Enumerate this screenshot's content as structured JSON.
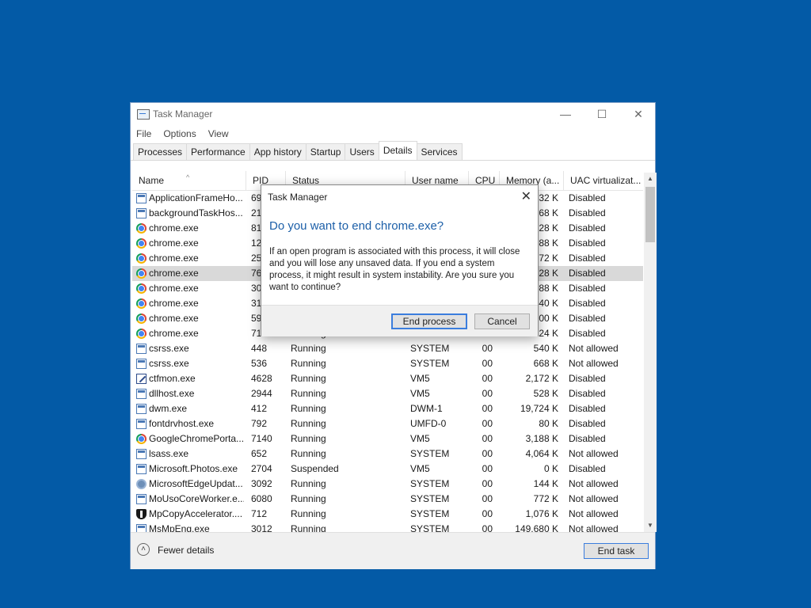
{
  "window": {
    "title": "Task Manager",
    "minimize_glyph": "—",
    "maximize_glyph": "☐",
    "close_glyph": "✕",
    "menu": [
      "File",
      "Options",
      "View"
    ],
    "tabs": [
      "Processes",
      "Performance",
      "App history",
      "Startup",
      "Users",
      "Details",
      "Services"
    ],
    "active_tab": "Details"
  },
  "table": {
    "columns": [
      "Name",
      "PID",
      "Status",
      "User name",
      "CPU",
      "Memory (a...",
      "UAC virtualizat..."
    ],
    "sort_glyph": "^",
    "rows": [
      {
        "icon": "app-window-icon",
        "name": "ApplicationFrameHo...",
        "pid": "69",
        "status": "",
        "user": "",
        "cpu": "",
        "mem": "32 K",
        "uac": "Disabled"
      },
      {
        "icon": "app-window-icon",
        "name": "backgroundTaskHos...",
        "pid": "21",
        "status": "",
        "user": "",
        "cpu": "",
        "mem": "68 K",
        "uac": "Disabled"
      },
      {
        "icon": "chrome-icon",
        "name": "chrome.exe",
        "pid": "81",
        "status": "",
        "user": "",
        "cpu": "",
        "mem": "28 K",
        "uac": "Disabled"
      },
      {
        "icon": "chrome-icon",
        "name": "chrome.exe",
        "pid": "12",
        "status": "",
        "user": "",
        "cpu": "",
        "mem": "88 K",
        "uac": "Disabled"
      },
      {
        "icon": "chrome-icon",
        "name": "chrome.exe",
        "pid": "25",
        "status": "",
        "user": "",
        "cpu": "",
        "mem": "72 K",
        "uac": "Disabled"
      },
      {
        "icon": "chrome-icon",
        "name": "chrome.exe",
        "pid": "76",
        "status": "",
        "user": "",
        "cpu": "",
        "mem": "28 K",
        "uac": "Disabled",
        "selected": true
      },
      {
        "icon": "chrome-icon",
        "name": "chrome.exe",
        "pid": "30",
        "status": "",
        "user": "",
        "cpu": "",
        "mem": "88 K",
        "uac": "Disabled"
      },
      {
        "icon": "chrome-icon",
        "name": "chrome.exe",
        "pid": "31",
        "status": "",
        "user": "",
        "cpu": "",
        "mem": "40 K",
        "uac": "Disabled"
      },
      {
        "icon": "chrome-icon",
        "name": "chrome.exe",
        "pid": "59",
        "status": "",
        "user": "",
        "cpu": "",
        "mem": "00 K",
        "uac": "Disabled"
      },
      {
        "icon": "chrome-icon",
        "name": "chrome.exe",
        "pid": "71",
        "status": "Running",
        "user": "VM5",
        "cpu": "",
        "mem": "024 K",
        "uac": "Disabled"
      },
      {
        "icon": "app-window-icon",
        "name": "csrss.exe",
        "pid": "448",
        "status": "Running",
        "user": "SYSTEM",
        "cpu": "00",
        "mem": "540 K",
        "uac": "Not allowed"
      },
      {
        "icon": "app-window-icon",
        "name": "csrss.exe",
        "pid": "536",
        "status": "Running",
        "user": "SYSTEM",
        "cpu": "00",
        "mem": "668 K",
        "uac": "Not allowed"
      },
      {
        "icon": "pen-icon",
        "name": "ctfmon.exe",
        "pid": "4628",
        "status": "Running",
        "user": "VM5",
        "cpu": "00",
        "mem": "2,172 K",
        "uac": "Disabled"
      },
      {
        "icon": "app-window-icon",
        "name": "dllhost.exe",
        "pid": "2944",
        "status": "Running",
        "user": "VM5",
        "cpu": "00",
        "mem": "528 K",
        "uac": "Disabled"
      },
      {
        "icon": "app-window-icon",
        "name": "dwm.exe",
        "pid": "412",
        "status": "Running",
        "user": "DWM-1",
        "cpu": "00",
        "mem": "19,724 K",
        "uac": "Disabled"
      },
      {
        "icon": "app-window-icon",
        "name": "fontdrvhost.exe",
        "pid": "792",
        "status": "Running",
        "user": "UMFD-0",
        "cpu": "00",
        "mem": "80 K",
        "uac": "Disabled"
      },
      {
        "icon": "chrome-icon",
        "name": "GoogleChromePorta...",
        "pid": "7140",
        "status": "Running",
        "user": "VM5",
        "cpu": "00",
        "mem": "3,188 K",
        "uac": "Disabled"
      },
      {
        "icon": "app-window-icon",
        "name": "lsass.exe",
        "pid": "652",
        "status": "Running",
        "user": "SYSTEM",
        "cpu": "00",
        "mem": "4,064 K",
        "uac": "Not allowed"
      },
      {
        "icon": "app-window-icon",
        "name": "Microsoft.Photos.exe",
        "pid": "2704",
        "status": "Suspended",
        "user": "VM5",
        "cpu": "00",
        "mem": "0 K",
        "uac": "Disabled"
      },
      {
        "icon": "gear-icon",
        "name": "MicrosoftEdgeUpdat...",
        "pid": "3092",
        "status": "Running",
        "user": "SYSTEM",
        "cpu": "00",
        "mem": "144 K",
        "uac": "Not allowed"
      },
      {
        "icon": "app-window-icon",
        "name": "MoUsoCoreWorker.e...",
        "pid": "6080",
        "status": "Running",
        "user": "SYSTEM",
        "cpu": "00",
        "mem": "772 K",
        "uac": "Not allowed"
      },
      {
        "icon": "shield-icon",
        "name": "MpCopyAccelerator....",
        "pid": "712",
        "status": "Running",
        "user": "SYSTEM",
        "cpu": "00",
        "mem": "1,076 K",
        "uac": "Not allowed"
      },
      {
        "icon": "app-window-icon",
        "name": "MsMpEng.exe",
        "pid": "3012",
        "status": "Running",
        "user": "SYSTEM",
        "cpu": "00",
        "mem": "149,680 K",
        "uac": "Not allowed"
      }
    ]
  },
  "footer": {
    "fewer_icon_glyph": "˄",
    "fewer_details": "Fewer details",
    "end_task": "End task"
  },
  "dialog": {
    "title": "Task Manager",
    "close_glyph": "✕",
    "heading": "Do you want to end chrome.exe?",
    "body": "If an open program is associated with this process, it will close and you will lose any unsaved data. If you end a system process, it might result in system instability. Are you sure you want to continue?",
    "end_process": "End process",
    "cancel": "Cancel"
  },
  "scroll_glyphs": {
    "up": "▲",
    "down": "▼"
  }
}
